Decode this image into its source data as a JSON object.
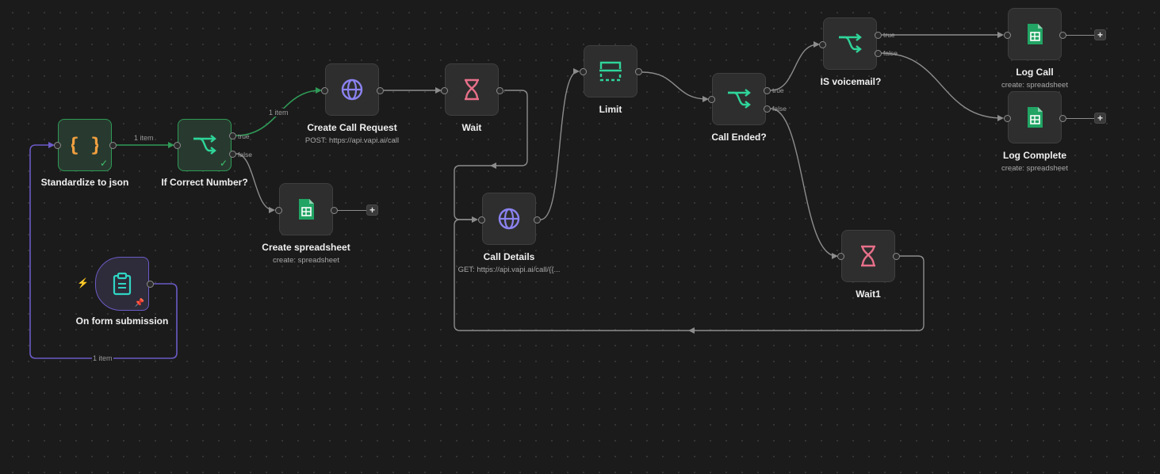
{
  "colors": {
    "canvas": "#1b1b1b",
    "node": "#2e2e2e",
    "success_border": "#2f9a57",
    "trigger_border": "#6b5bc7",
    "edge_default": "#8c8c8c",
    "edge_success": "#2f9a57",
    "edge_trigger": "#6b5bc7",
    "sheets_green": "#21a464",
    "http_purple": "#8b83f0",
    "wait_pink": "#e8708a",
    "teal": "#2fd5b0"
  },
  "nodes": {
    "standardize": {
      "label": "Standardize to json",
      "icon": "braces-icon",
      "status": "success"
    },
    "if_correct": {
      "label": "If Correct Number?",
      "icon": "if-branch-icon",
      "status": "success",
      "true_label": "true",
      "false_label": "false"
    },
    "create_call": {
      "label": "Create Call Request",
      "subtitle": "POST: https://api.vapi.ai/call",
      "icon": "globe-icon"
    },
    "wait": {
      "label": "Wait",
      "icon": "hourglass-icon"
    },
    "create_sheet": {
      "label": "Create spreadsheet",
      "subtitle": "create: spreadsheet",
      "icon": "google-sheets-icon"
    },
    "form": {
      "label": "On form submission",
      "icon": "clipboard-icon",
      "trigger": true,
      "pinned": true
    },
    "call_details": {
      "label": "Call Details",
      "subtitle": "GET: https://api.vapi.ai/call/{{...",
      "icon": "globe-icon"
    },
    "limit": {
      "label": "Limit",
      "icon": "limit-icon"
    },
    "call_ended": {
      "label": "Call Ended?",
      "icon": "if-branch-icon",
      "true_label": "true",
      "false_label": "false"
    },
    "voicemail": {
      "label": "IS voicemail?",
      "icon": "if-branch-icon",
      "true_label": "true",
      "false_label": "false"
    },
    "log_call": {
      "label": "Log Call",
      "subtitle": "create: spreadsheet",
      "icon": "google-sheets-icon"
    },
    "log_complete": {
      "label": "Log Complete",
      "subtitle": "create: spreadsheet",
      "icon": "google-sheets-icon"
    },
    "wait1": {
      "label": "Wait1",
      "icon": "hourglass-icon"
    }
  },
  "edge_labels": {
    "standardize_to_if": "1 item",
    "if_to_create_call": "1 item",
    "form_to_standardize": "1 item"
  },
  "add_button_label": "+"
}
